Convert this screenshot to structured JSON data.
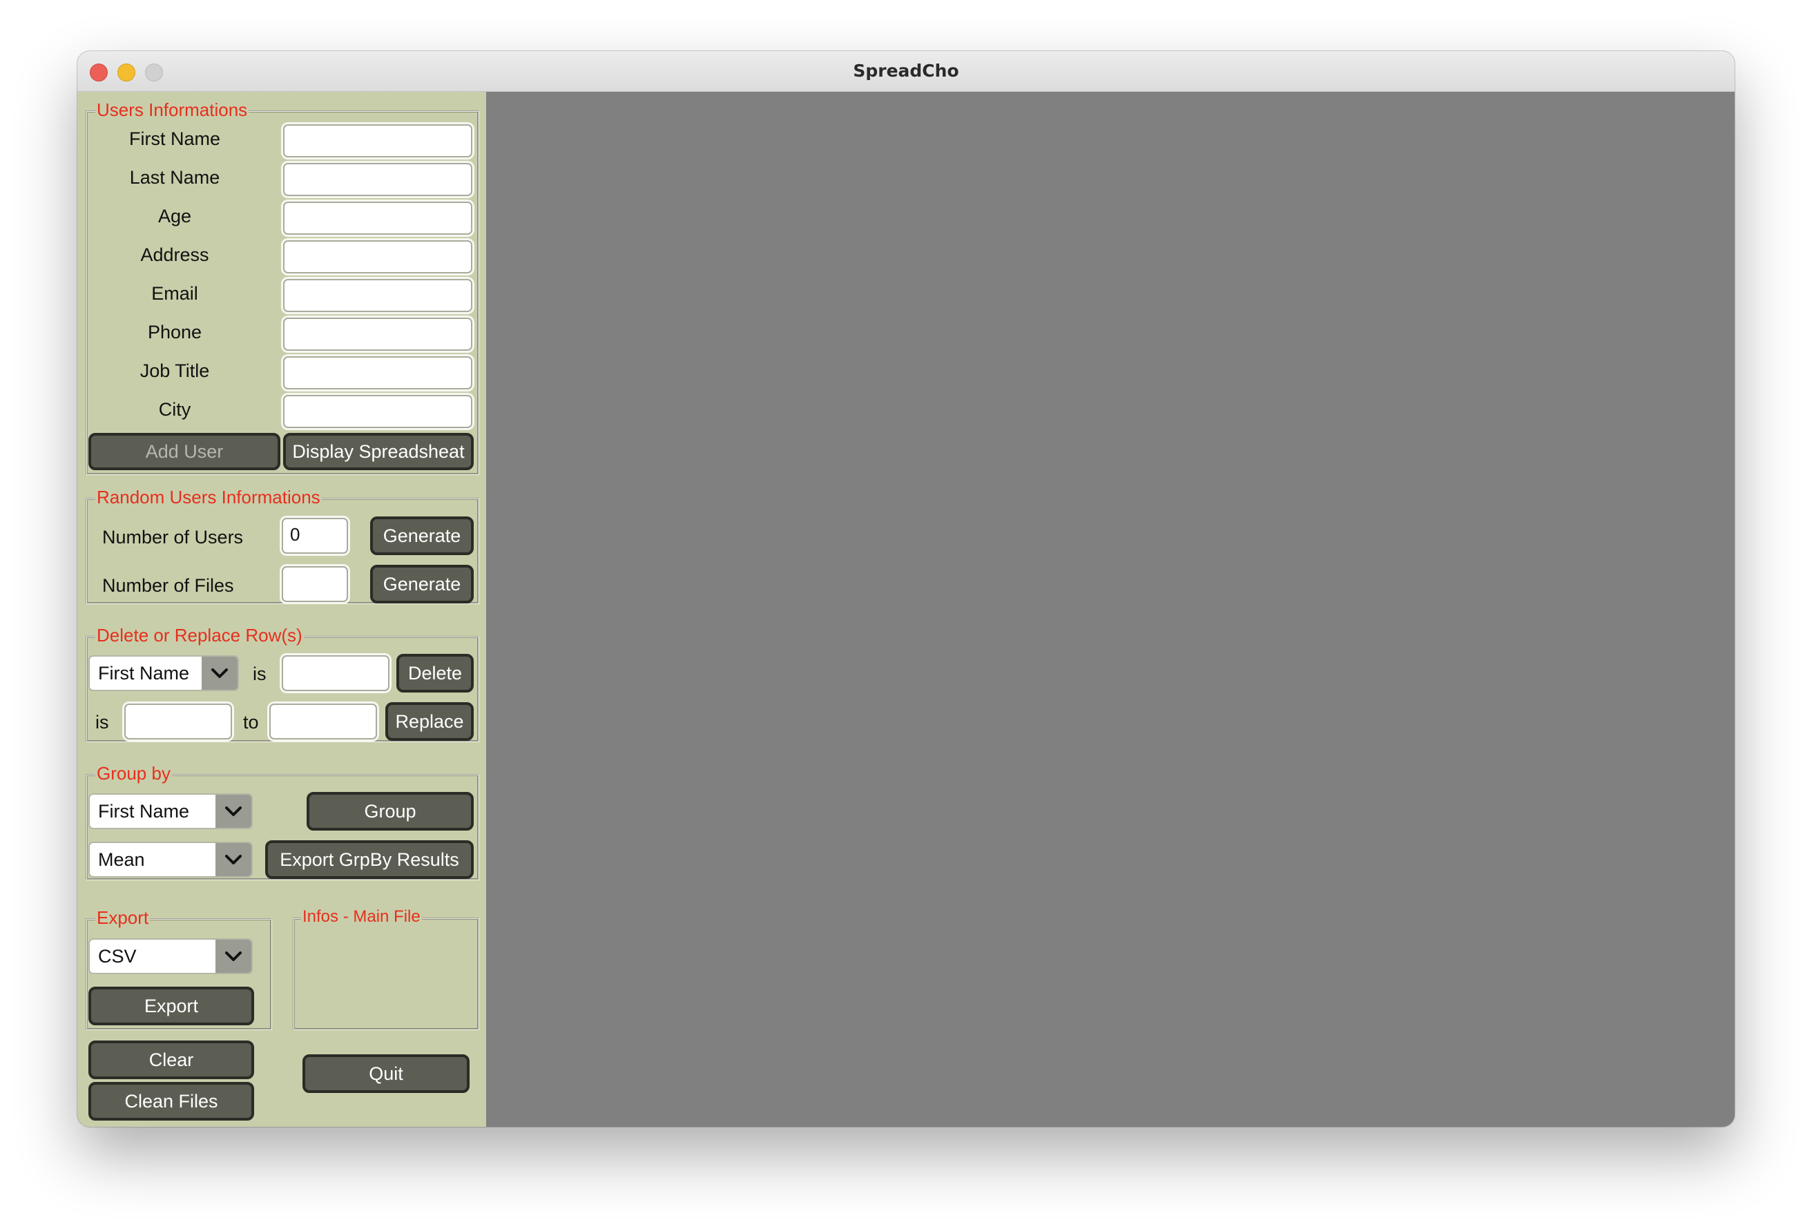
{
  "window": {
    "title": "SpreadCho"
  },
  "users_info": {
    "legend": "Users Informations",
    "fields": [
      {
        "label": "First Name",
        "value": ""
      },
      {
        "label": "Last Name",
        "value": ""
      },
      {
        "label": "Age",
        "value": ""
      },
      {
        "label": "Address",
        "value": ""
      },
      {
        "label": "Email",
        "value": ""
      },
      {
        "label": "Phone",
        "value": ""
      },
      {
        "label": "Job Title",
        "value": ""
      },
      {
        "label": "City",
        "value": ""
      }
    ],
    "add_user_label": "Add User",
    "display_label": "Display Spreadsheat"
  },
  "random_users": {
    "legend": "Random Users Informations",
    "users_label": "Number of Users",
    "users_value": "0",
    "files_label": "Number of Files",
    "files_value": "",
    "generate_label": "Generate"
  },
  "delete_replace": {
    "legend": "Delete or Replace Row(s)",
    "column_selected": "First Name",
    "is_label": "is",
    "to_label": "to",
    "delete_value": "",
    "replace_from_value": "",
    "replace_to_value": "",
    "delete_label": "Delete",
    "replace_label": "Replace"
  },
  "group_by": {
    "legend": "Group by",
    "column_selected": "First Name",
    "aggregate_selected": "Mean",
    "group_label": "Group",
    "export_label": "Export GrpBy Results"
  },
  "export": {
    "legend": "Export",
    "format_selected": "CSV",
    "export_label": "Export"
  },
  "infos": {
    "legend": "Infos - Main File"
  },
  "bottom": {
    "clear_label": "Clear",
    "clean_files_label": "Clean Files",
    "quit_label": "Quit"
  },
  "icons": {
    "dropdown": "chevron-down-icon"
  },
  "colors": {
    "sidebar_bg": "#c9ceaa",
    "legend_text": "#e62f1e",
    "button_bg": "#5c5e53",
    "main_bg": "#808080"
  }
}
